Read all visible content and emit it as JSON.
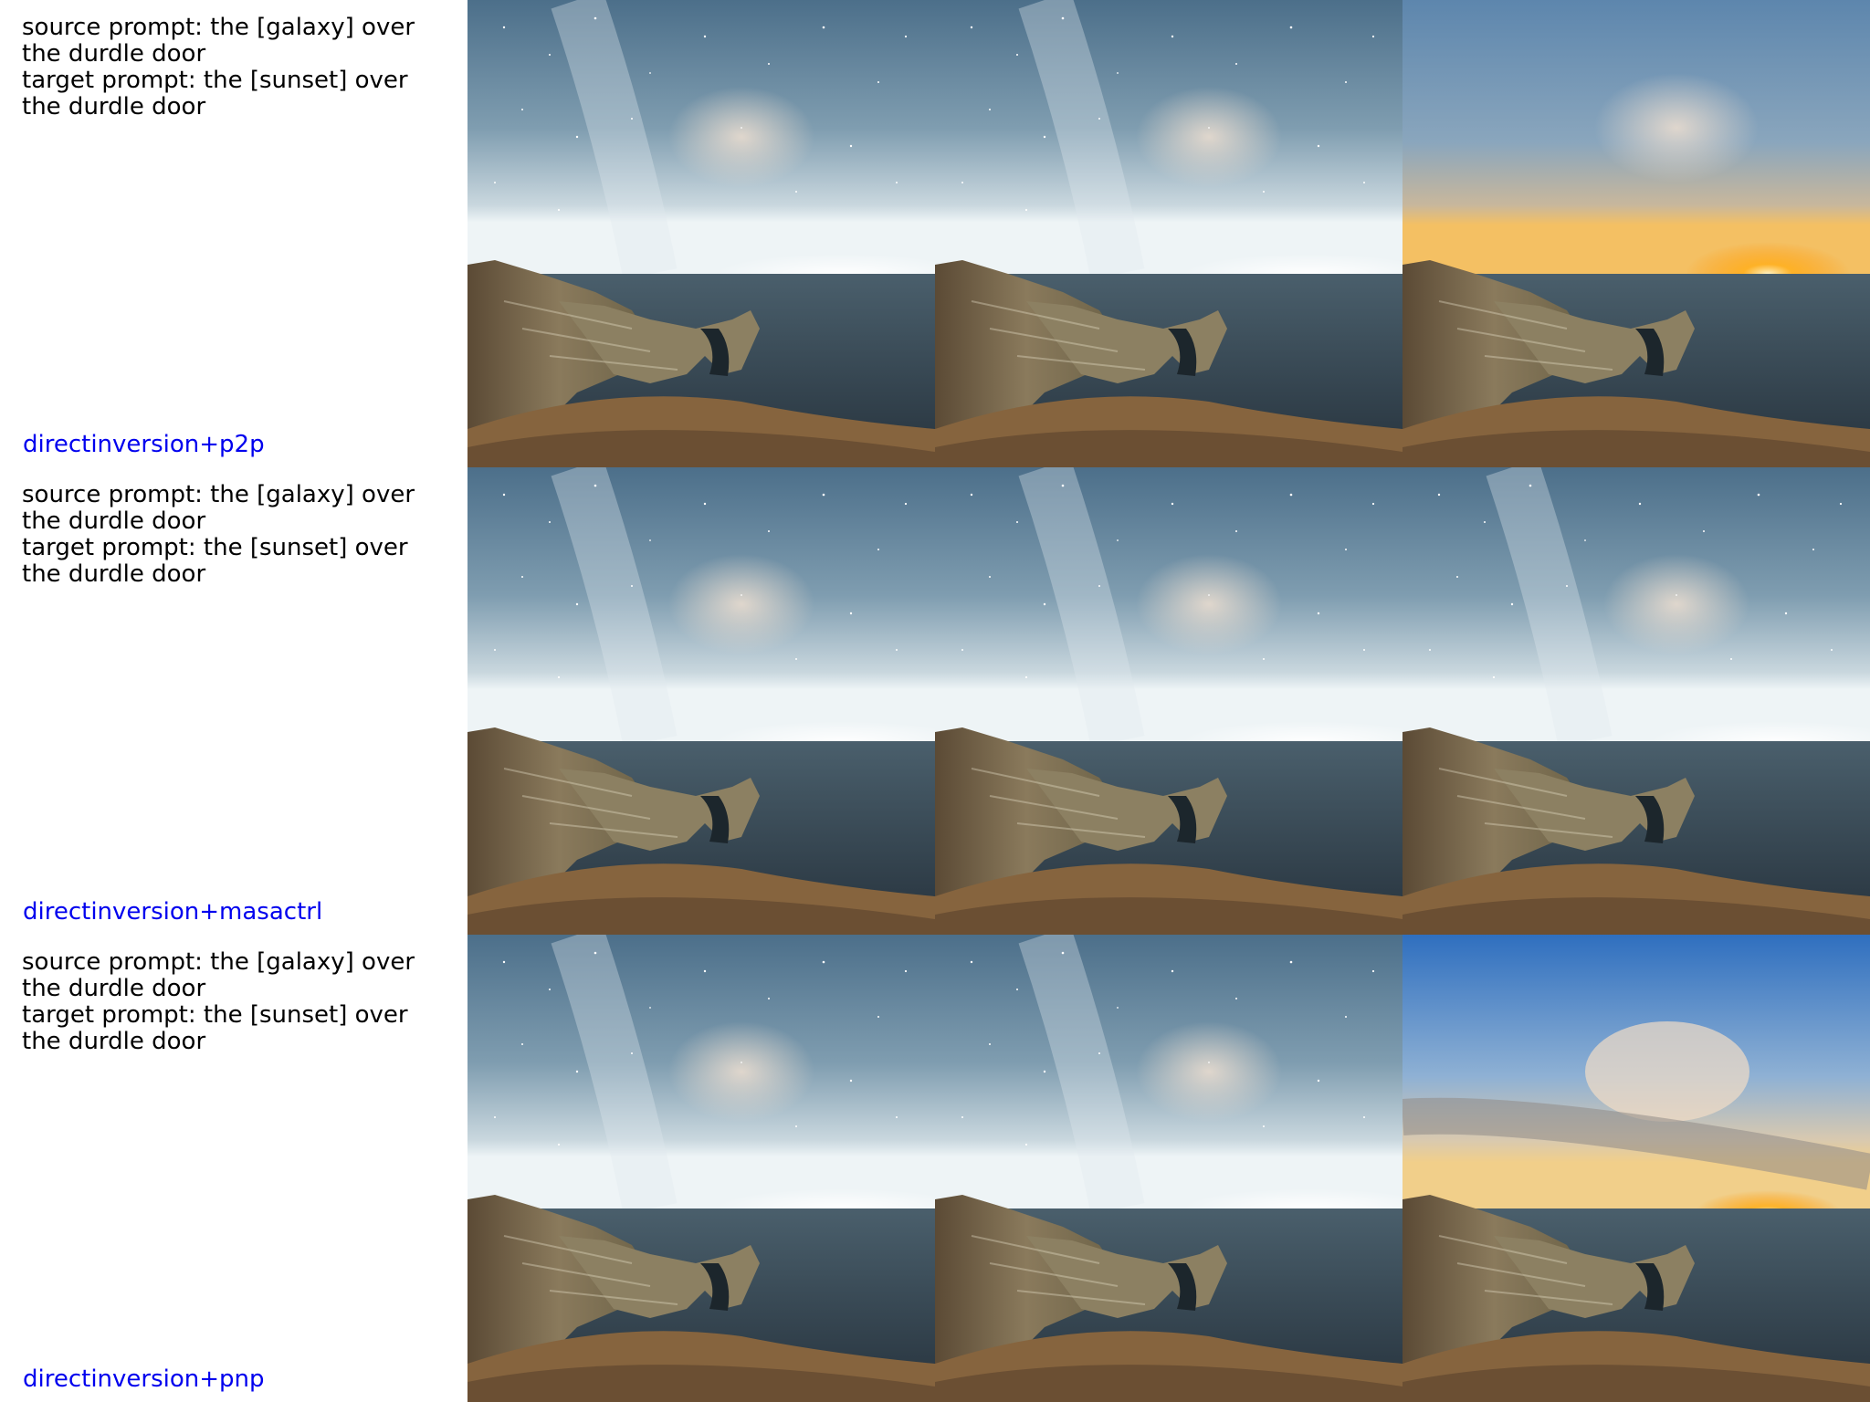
{
  "rows": [
    {
      "source_prompt": "source prompt: the [galaxy] over the durdle door",
      "target_prompt": "target prompt: the [sunset] over the durdle door",
      "method": "directinversion+p2p",
      "images": [
        "night",
        "night",
        "sunset"
      ]
    },
    {
      "source_prompt": "source prompt: the [galaxy] over the durdle door",
      "target_prompt": "target prompt: the [sunset] over the durdle door",
      "method": "directinversion+masactrl",
      "images": [
        "night",
        "night",
        "night"
      ]
    },
    {
      "source_prompt": "source prompt: the [galaxy] over the durdle door",
      "target_prompt": "target prompt: the [sunset] over the durdle door",
      "method": "directinversion+pnp",
      "images": [
        "night",
        "night",
        "day-sunset"
      ]
    }
  ],
  "colors": {
    "method_label": "#0000ee",
    "night_sky": "#5a7c95",
    "sunset_sun": "#ffb020",
    "day_sky": "#3f7fc7"
  }
}
